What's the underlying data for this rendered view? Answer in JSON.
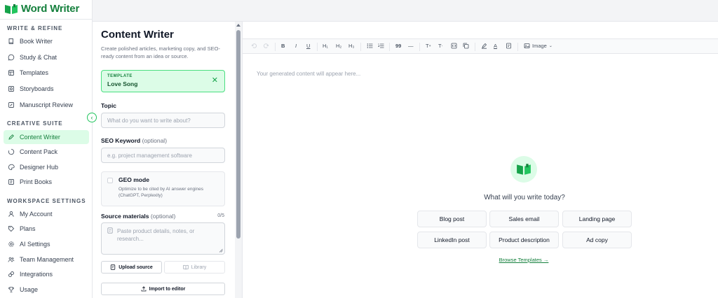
{
  "app": {
    "name": "Word Writer"
  },
  "sidebar": {
    "sections": [
      {
        "title": "WRITE & REFINE"
      },
      {
        "title": "CREATIVE SUITE"
      },
      {
        "title": "WORKSPACE SETTINGS"
      }
    ],
    "items": [
      {
        "label": "Book Writer",
        "icon": "book-icon"
      },
      {
        "label": "Study & Chat",
        "icon": "chat-icon"
      },
      {
        "label": "Templates",
        "icon": "template-icon"
      },
      {
        "label": "Storyboards",
        "icon": "storyboard-icon"
      },
      {
        "label": "Manuscript Review",
        "icon": "review-icon"
      },
      {
        "label": "Content Writer",
        "icon": "pencil-icon",
        "active": true
      },
      {
        "label": "Content Pack",
        "icon": "spinner-icon"
      },
      {
        "label": "Designer Hub",
        "icon": "palette-icon"
      },
      {
        "label": "Print Books",
        "icon": "print-icon"
      },
      {
        "label": "My Account",
        "icon": "user-icon"
      },
      {
        "label": "Plans",
        "icon": "tag-icon"
      },
      {
        "label": "AI Settings",
        "icon": "gear-icon"
      },
      {
        "label": "Team Management",
        "icon": "team-icon"
      },
      {
        "label": "Integrations",
        "icon": "plug-icon"
      },
      {
        "label": "Usage",
        "icon": "trophy-icon"
      }
    ]
  },
  "form": {
    "title": "Content Writer",
    "subtitle": "Create polished articles, marketing copy, and SEO-ready content from an idea or source.",
    "template": {
      "label": "TEMPLATE",
      "value": "Love Song",
      "close": "✕"
    },
    "topic": {
      "label": "Topic",
      "placeholder": "What do you want to write about?"
    },
    "seo": {
      "label": "SEO Keyword",
      "optional": "(optional)",
      "placeholder": "e.g. project management software"
    },
    "geo": {
      "title": "GEO mode",
      "description": "Optimize to be cited by AI answer engines (ChatGPT, Perplexity)"
    },
    "source": {
      "label": "Source materials",
      "optional": "(optional)",
      "counter": "0/5",
      "placeholder": "Paste product details, notes, or research..."
    },
    "upload_label": "Upload source",
    "library_label": "Library",
    "import_label": "Import to editor"
  },
  "editor": {
    "toolbar": {
      "h1": "H₁",
      "h2": "H₂",
      "h3": "H₃",
      "quote": "99",
      "hr": "—",
      "image": "Image"
    },
    "placeholder": "Your generated content will appear here...",
    "prompt": "What will you write today?",
    "suggestions": [
      "Blog post",
      "Sales email",
      "Landing page",
      "LinkedIn post",
      "Product description",
      "Ad copy"
    ],
    "browse": "Browse Templates →"
  },
  "colors": {
    "brand": "#15803d",
    "accent_bg": "#dcfce7"
  }
}
